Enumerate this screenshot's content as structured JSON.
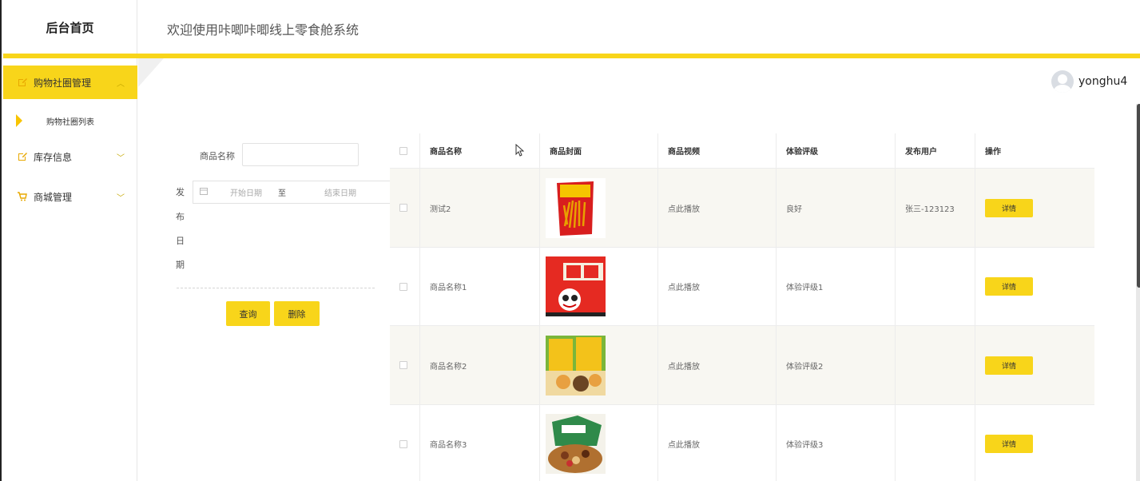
{
  "app": {
    "home_label": "后台首页",
    "welcome": "欢迎使用咔唧咔唧线上零食舱系统",
    "username": "yonghu4",
    "accent_color": "#f8d51a"
  },
  "sidebar": {
    "items": [
      {
        "label": "购物社圈管理",
        "icon": "edit-icon",
        "expanded": true
      },
      {
        "label": "库存信息",
        "icon": "edit-icon",
        "expanded": false
      },
      {
        "label": "商城管理",
        "icon": "cart-icon",
        "expanded": false
      }
    ],
    "sub_items": [
      {
        "label": "购物社圈列表"
      }
    ]
  },
  "search": {
    "name_label": "商品名称",
    "name_value": "",
    "date_label_chars": [
      "发",
      "布",
      "日",
      "期"
    ],
    "start_placeholder": "开始日期",
    "range_sep": "至",
    "end_placeholder": "结束日期",
    "query_button": "查询",
    "delete_button": "删除"
  },
  "table": {
    "headers": [
      "商品名称",
      "商品封面",
      "商品视频",
      "体验评级",
      "发布用户",
      "操作"
    ],
    "rows": [
      {
        "name": "测试2",
        "cover": "chips-bag",
        "video": "点此播放",
        "rating": "良好",
        "user": "张三-123123",
        "action": "详情"
      },
      {
        "name": "商品名称1",
        "cover": "milk-box",
        "video": "点此播放",
        "rating": "体验评级1",
        "user": "",
        "action": "详情"
      },
      {
        "name": "商品名称2",
        "cover": "snack-pack",
        "video": "点此播放",
        "rating": "体验评级2",
        "user": "",
        "action": "详情"
      },
      {
        "name": "商品名称3",
        "cover": "nut-basket",
        "video": "点此播放",
        "rating": "体验评级3",
        "user": "",
        "action": "详情"
      }
    ]
  }
}
